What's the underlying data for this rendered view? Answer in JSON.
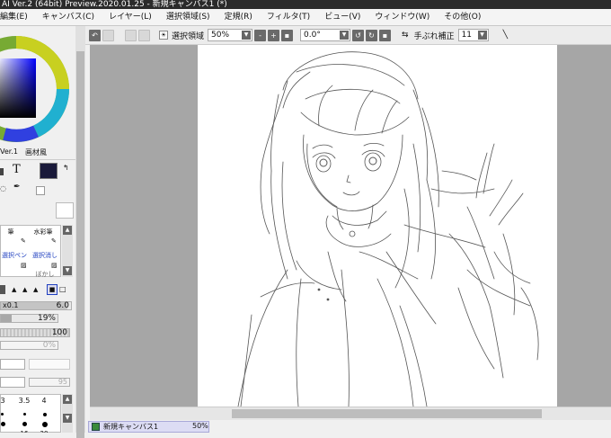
{
  "window": {
    "title": "AI Ver.2 (64bit) Preview.2020.01.25 - 新規キャンバス1 (*)"
  },
  "menu": [
    {
      "label": "編集(E)"
    },
    {
      "label": "キャンバス(C)"
    },
    {
      "label": "レイヤー(L)"
    },
    {
      "label": "選択領域(S)"
    },
    {
      "label": "定規(R)"
    },
    {
      "label": "フィルタ(T)"
    },
    {
      "label": "ビュー(V)"
    },
    {
      "label": "ウィンドウ(W)"
    },
    {
      "label": "その他(O)"
    }
  ],
  "toolbar": {
    "selection_label": "選択領域",
    "zoom_value": "50%",
    "zoom_minus": "-",
    "zoom_plus": "+",
    "zoom_reset": "▪",
    "angle_value": "0.0°",
    "stabilizer_label": "手ぶれ補正",
    "stabilizer_value": "11"
  },
  "left_panel": {
    "version_label": "Ver.1",
    "paper_label": "画材風",
    "text_tool": "T",
    "brushes": [
      {
        "label": "筆"
      },
      {
        "label": "水彩筆"
      },
      {
        "label": "選択ペン"
      },
      {
        "label": "選択消し"
      },
      {
        "label": "ぼかし"
      }
    ],
    "size_multiplier": "x0.1",
    "size_value": "6.0",
    "density_value": "19%",
    "pressure_value": "100",
    "blend_value": "0%",
    "mix_value": "95",
    "brush_sizes": [
      "3",
      "3.5",
      "4",
      "16",
      "20"
    ]
  },
  "status": {
    "canvas_name": "新規キャンバス1",
    "zoom": "50%"
  },
  "colors": {
    "current_color": "#1a1a3a",
    "canvas_bg": "#a6a6a6"
  }
}
